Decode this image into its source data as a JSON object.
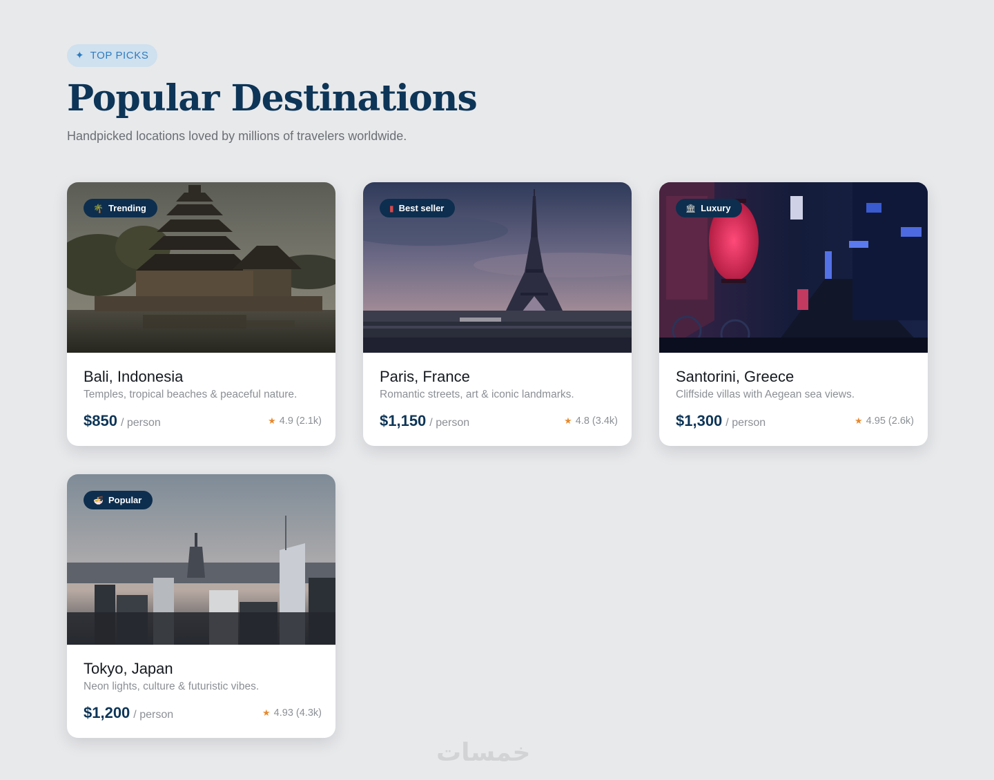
{
  "header": {
    "eyebrow": "TOP PICKS",
    "eyebrow_icon": "sparkle-icon",
    "title": "Popular Destinations",
    "subtitle": "Handpicked locations loved by millions of travelers worldwide."
  },
  "colors": {
    "background": "#e8e9eb",
    "brand_navy": "#0d3557",
    "eyebrow_bg": "#cfe0ee",
    "eyebrow_text": "#2d7bc0",
    "star": "#e68a2e",
    "muted_text": "#8b8f94"
  },
  "cards": [
    {
      "badge": "Trending",
      "badge_icon": "palm-tree-icon",
      "image": "bali-temple-photo",
      "name": "Bali, Indonesia",
      "description": "Temples, tropical beaches & peaceful nature.",
      "price": "$850",
      "per": "/ person",
      "rating": "4.9 (2.1k)"
    },
    {
      "badge": "Best seller",
      "badge_icon": "wine-bottle-icon",
      "image": "paris-eiffel-photo",
      "name": "Paris, France",
      "description": "Romantic streets, art & iconic landmarks.",
      "price": "$1,150",
      "per": "/ person",
      "rating": "4.8 (3.4k)"
    },
    {
      "badge": "Luxury",
      "badge_icon": "classical-building-icon",
      "image": "neon-alley-photo",
      "name": "Santorini, Greece",
      "description": "Cliffside villas with Aegean sea views.",
      "price": "$1,300",
      "per": "/ person",
      "rating": "4.95 (2.6k)"
    },
    {
      "badge": "Popular",
      "badge_icon": "noodle-bowl-icon",
      "image": "city-skyline-photo",
      "name": "Tokyo, Japan",
      "description": "Neon lights, culture & futuristic vibes.",
      "price": "$1,200",
      "per": "/ person",
      "rating": "4.93 (4.3k)"
    }
  ],
  "watermark": "خمسات"
}
